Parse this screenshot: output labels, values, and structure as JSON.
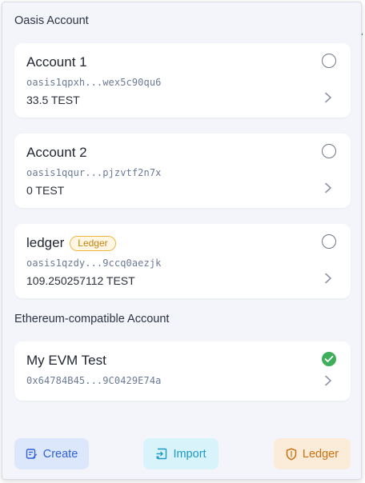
{
  "oasis_section": {
    "title": "Oasis Account"
  },
  "oasis_accounts": [
    {
      "name": "Account 1",
      "address": "oasis1qpxh...wex5c90qu6",
      "balance": "33.5 TEST",
      "badge": "",
      "selected": false
    },
    {
      "name": "Account 2",
      "address": "oasis1qqur...pjzvtf2n7x",
      "balance": "0 TEST",
      "badge": "",
      "selected": false
    },
    {
      "name": "ledger",
      "address": "oasis1qzdy...9ccq0aezjk",
      "balance": "109.250257112 TEST",
      "badge": "Ledger",
      "selected": false
    }
  ],
  "evm_section": {
    "title": "Ethereum-compatible Account"
  },
  "evm_accounts": [
    {
      "name": "My EVM Test",
      "address": "0x64784B45...9C0429E74a",
      "selected": true
    }
  ],
  "footer": {
    "create_label": "Create",
    "import_label": "Import",
    "ledger_label": "Ledger"
  },
  "colors": {
    "panel_bg": "#f3f5fa",
    "selected_green": "#3fae5a",
    "ledger_badge": "#f0b543",
    "create_accent": "#2f62d6",
    "import_accent": "#1c9ac4",
    "ledger_accent": "#c9700f"
  },
  "icons": [
    "radio-unchecked-icon",
    "check-circle-icon",
    "chevron-right-icon",
    "create-account-icon",
    "import-icon",
    "ledger-shield-icon"
  ]
}
